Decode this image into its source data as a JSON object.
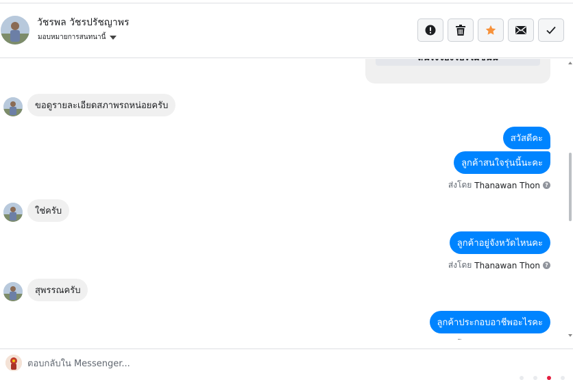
{
  "contact": {
    "name": "วัชรพล วัชรปรัชญาพร",
    "assignment": "มอบหมายการสนทนานี้"
  },
  "actions": [
    {
      "icon": "alert-icon",
      "label": "Mark as spam"
    },
    {
      "icon": "trash-icon",
      "label": "Delete"
    },
    {
      "icon": "star-icon",
      "label": "Follow up",
      "color": "#f7923b"
    },
    {
      "icon": "envelope-icon",
      "label": "Mark as unread"
    },
    {
      "icon": "check-icon",
      "label": "Mark as done"
    }
  ],
  "thread": {
    "card_button": "สนใจจองโปรโมชั่นนี้",
    "messages": [
      {
        "side": "in",
        "text": "ขอดูรายละเอียดสภาพรถหน่อยครับ"
      },
      {
        "side": "out",
        "text": "สวัสดีคะ"
      },
      {
        "side": "out",
        "text": "ลูกค้าสนใจรุ่นนี้นะคะ"
      },
      {
        "side": "in",
        "text": "ใช่ครับ"
      },
      {
        "side": "out",
        "text": "ลูกค้าอยู่จังหวัดไหนคะ"
      },
      {
        "side": "in",
        "text": "สุพรรณครับ"
      },
      {
        "side": "out",
        "text": "ลูกค้าประกอบอาชีพอะไรคะ"
      }
    ],
    "sent_by_label": "ส่งโดย",
    "sender_name": "Thanawan Thon"
  },
  "composer": {
    "placeholder": "ตอบกลับใน Messenger..."
  },
  "colors": {
    "outgoing_bubble": "#0084ff",
    "incoming_bubble": "#f0f0f0",
    "star": "#f7923b"
  }
}
